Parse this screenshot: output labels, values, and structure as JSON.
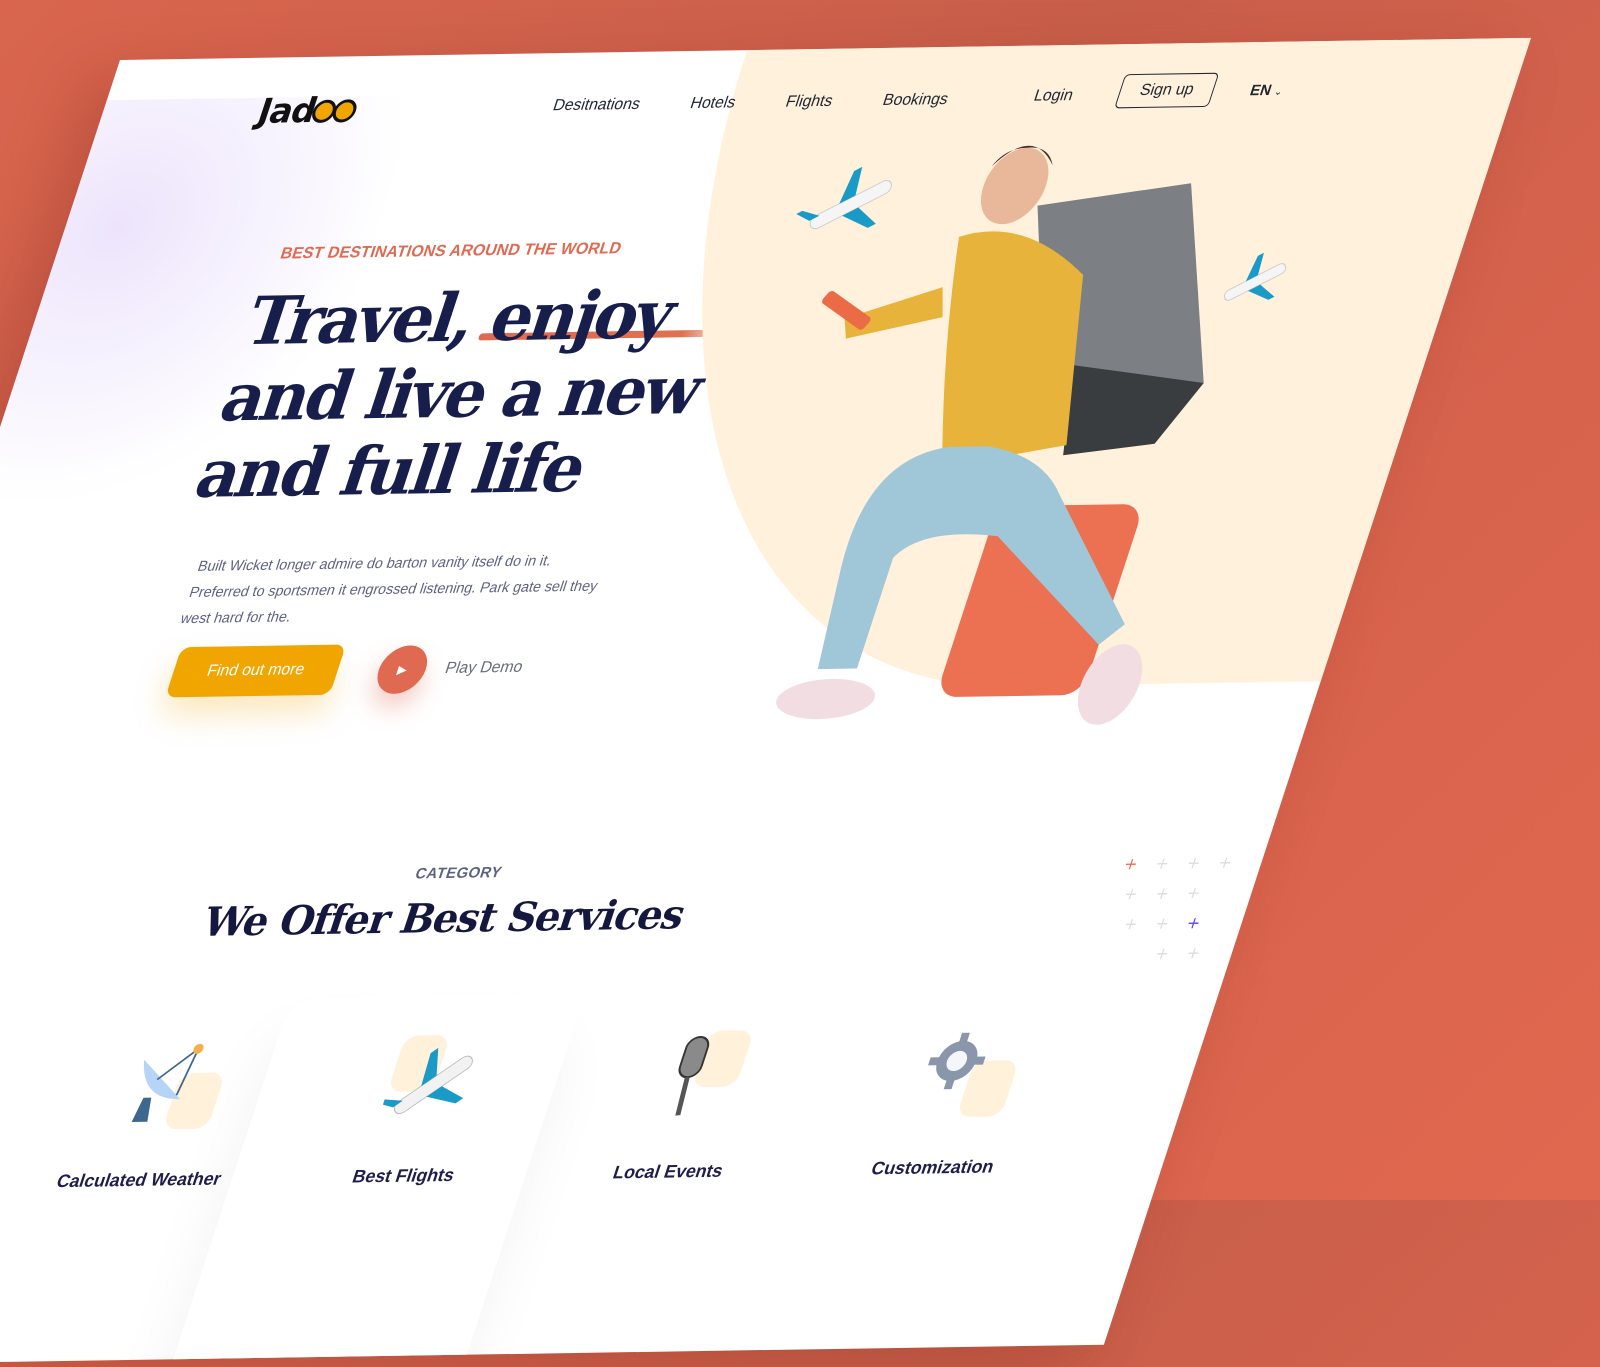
{
  "brand": {
    "name_prefix": "Jad",
    "accent_color": "#f1a501",
    "primary_color": "#181e4b",
    "coral_color": "#df6951"
  },
  "nav": {
    "items": [
      {
        "label": "Desitnations"
      },
      {
        "label": "Hotels"
      },
      {
        "label": "Flights"
      },
      {
        "label": "Bookings"
      }
    ],
    "login_label": "Login",
    "signup_label": "Sign up",
    "language": "EN"
  },
  "hero": {
    "eyebrow": "BEST DESTINATIONS AROUND THE WORLD",
    "headline_part1": "Travel,",
    "headline_underlined": "enjoy",
    "headline_part2": "and live a new and full life",
    "description": "Built Wicket longer admire do barton vanity itself do in it. Preferred to sportsmen it engrossed listening. Park gate sell they west hard for the.",
    "cta_label": "Find out more",
    "play_label": "Play Demo"
  },
  "services": {
    "category_label": "CATEGORY",
    "title": "We Offer Best Services",
    "items": [
      {
        "label": "Calculated Weather",
        "icon": "satellite-dish-icon"
      },
      {
        "label": "Best Flights",
        "icon": "airplane-icon"
      },
      {
        "label": "Local Events",
        "icon": "microphone-icon"
      },
      {
        "label": "Customization",
        "icon": "gear-icon"
      }
    ]
  }
}
